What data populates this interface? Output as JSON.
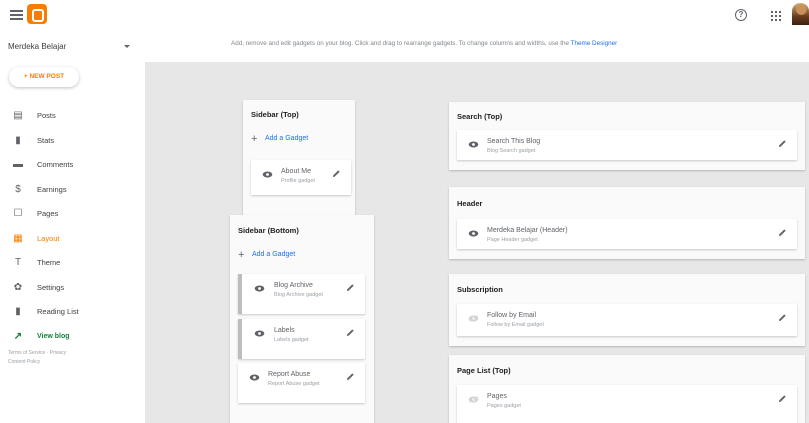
{
  "header": {
    "help_icon": "help-icon",
    "apps_icon": "apps-grid-icon"
  },
  "sidebar": {
    "blog_name": "Merdeka Belajar",
    "new_post_label": "+ NEW POST",
    "items": [
      {
        "label": "Posts",
        "icon": "posts-icon",
        "glyph": "▤"
      },
      {
        "label": "Stats",
        "icon": "stats-icon",
        "glyph": "▮"
      },
      {
        "label": "Comments",
        "icon": "comments-icon",
        "glyph": "▬"
      },
      {
        "label": "Earnings",
        "icon": "earnings-icon",
        "glyph": "$"
      },
      {
        "label": "Pages",
        "icon": "pages-icon",
        "glyph": "☐"
      },
      {
        "label": "Layout",
        "icon": "layout-icon",
        "glyph": "▦"
      },
      {
        "label": "Theme",
        "icon": "theme-icon",
        "glyph": "T"
      },
      {
        "label": "Settings",
        "icon": "settings-icon",
        "glyph": "✿"
      },
      {
        "label": "Reading List",
        "icon": "reading-list-icon",
        "glyph": "▮"
      },
      {
        "label": "View blog",
        "icon": "view-blog-icon",
        "glyph": "↗"
      }
    ],
    "footer": {
      "terms": "Terms of Service",
      "privacy": "Privacy",
      "content_policy": "Content Policy"
    }
  },
  "main": {
    "instructions": "Add, remove and edit gadgets on your blog. Click and drag to rearrange gadgets. To change columns and widths, use the",
    "theme_designer_link": "Theme Designer",
    "sections": {
      "sidebar_top": {
        "title": "Sidebar (Top)",
        "add_gadget": "Add a Gadget",
        "gadgets": [
          {
            "name": "About Me",
            "type": "Profile gadget"
          }
        ]
      },
      "sidebar_bottom": {
        "title": "Sidebar (Bottom)",
        "add_gadget": "Add a Gadget",
        "gadgets": [
          {
            "name": "Blog Archive",
            "type": "Blog Archive gadget"
          },
          {
            "name": "Labels",
            "type": "Labels gadget"
          },
          {
            "name": "Report Abuse",
            "type": "Report Abuse gadget"
          }
        ]
      },
      "search_top": {
        "title": "Search (Top)",
        "gadgets": [
          {
            "name": "Search This Blog",
            "type": "Blog Search gadget"
          }
        ]
      },
      "header": {
        "title": "Header",
        "gadgets": [
          {
            "name": "Merdeka Belajar (Header)",
            "type": "Page Header gadget"
          }
        ]
      },
      "subscription": {
        "title": "Subscription",
        "gadgets": [
          {
            "name": "Follow by Email",
            "type": "Follow by Email gadget"
          }
        ]
      },
      "page_list_top": {
        "title": "Page List (Top)",
        "gadgets": [
          {
            "name": "Pages",
            "type": "Pages gadget"
          }
        ]
      }
    }
  },
  "colors": {
    "accent": "#f57d00",
    "link": "#1a73e8",
    "view_blog": "#188038"
  }
}
